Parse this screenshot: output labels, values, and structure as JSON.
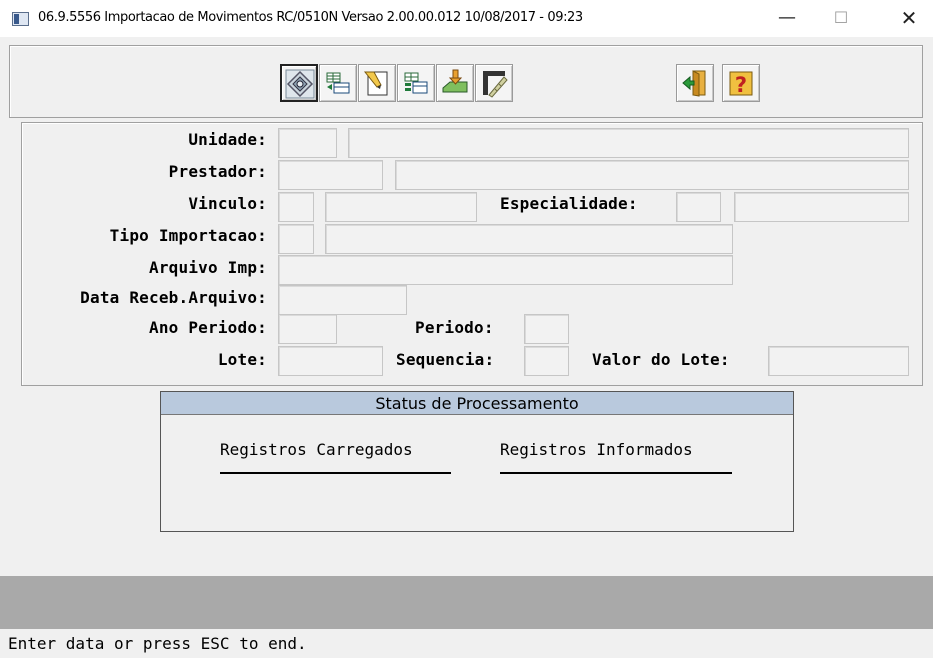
{
  "window": {
    "title": "06.9.5556 Importacao de Movimentos RC/0510N Versao 2.00.00.012 10/08/2017 - 09:23",
    "minimize_glyph": "—",
    "maximize_glyph": "☐",
    "close_glyph": "✕"
  },
  "toolbar": {
    "buttons": [
      {
        "name": "process-icon"
      },
      {
        "name": "import-table-icon"
      },
      {
        "name": "edit-document-icon"
      },
      {
        "name": "grid-icon"
      },
      {
        "name": "download-icon"
      },
      {
        "name": "ruler-icon"
      },
      {
        "name": "exit-door-icon"
      },
      {
        "name": "help-icon"
      }
    ]
  },
  "form": {
    "unidade_label": "Unidade:",
    "unidade_code": "",
    "unidade_desc": "",
    "prestador_label": "Prestador:",
    "prestador_code": "",
    "prestador_desc": "",
    "vinculo_label": "Vinculo:",
    "vinculo_code": "",
    "vinculo_desc": "",
    "especialidade_label": "Especialidade:",
    "especialidade_code": "",
    "especialidade_desc": "",
    "tipo_importacao_label": "Tipo Importacao:",
    "tipo_importacao_code": "",
    "tipo_importacao_desc": "",
    "arquivo_imp_label": "Arquivo Imp:",
    "arquivo_imp_value": "",
    "data_receb_label": "Data Receb.Arquivo:",
    "data_receb_value": "",
    "ano_periodo_label": "Ano Periodo:",
    "ano_periodo_value": "",
    "periodo_label": "Periodo:",
    "periodo_value": "",
    "lote_label": "Lote:",
    "lote_value": "",
    "sequencia_label": "Sequencia:",
    "sequencia_value": "",
    "valor_lote_label": "Valor do Lote:",
    "valor_lote_value": ""
  },
  "status_panel": {
    "title": "Status de Processamento",
    "col1": "Registros Carregados",
    "col2": "Registros Informados"
  },
  "statusbar": {
    "message": "Enter data or press ESC to end."
  },
  "colors": {
    "panel_header": "#b9c9dd",
    "grey_bar": "#a9a9a9",
    "background": "#f0f0f0"
  }
}
